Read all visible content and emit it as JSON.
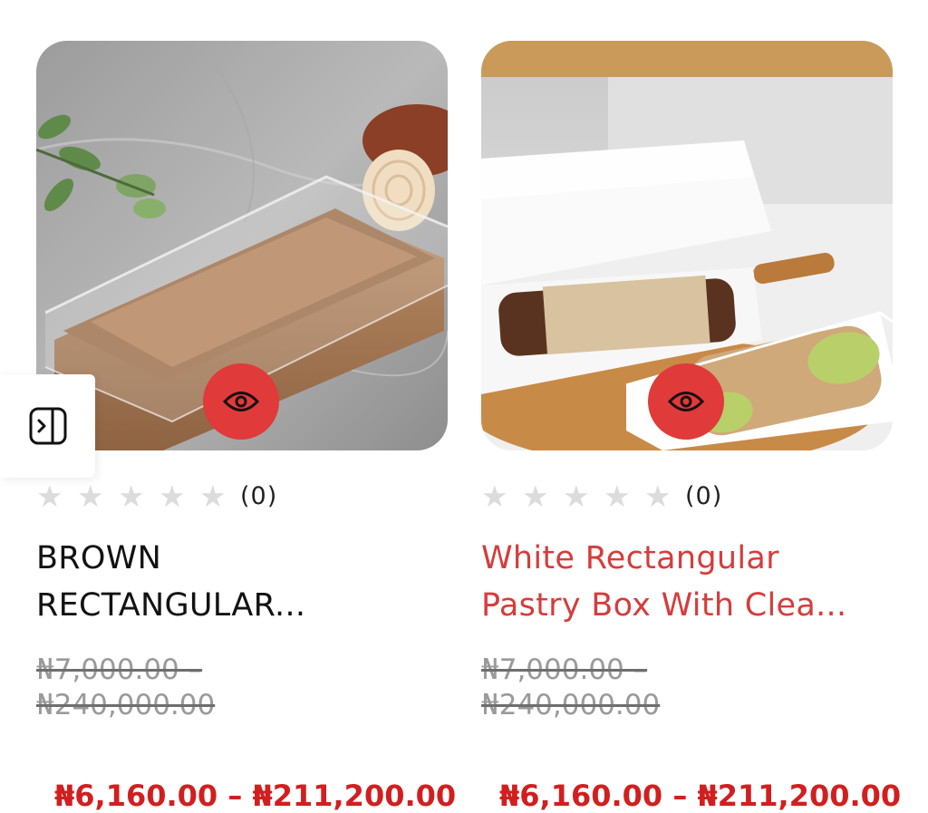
{
  "products": [
    {
      "title_lines": [
        "BROWN",
        "RECTANGULAR..."
      ],
      "rating_count": "(0)",
      "stars": 0,
      "old_price_lines": [
        "₦7,000.00 –",
        "₦240,000.00"
      ],
      "new_price": "₦6,160.00 – ₦211,200.00"
    },
    {
      "title_lines": [
        "White Rectangular",
        "Pastry Box With Clea..."
      ],
      "rating_count": "(0)",
      "stars": 0,
      "old_price_lines": [
        "₦7,000.00 –",
        "₦240,000.00"
      ],
      "new_price": "₦6,160.00 – ₦211,200.00"
    }
  ],
  "icons": {
    "quick_view": "eye-icon",
    "sidebar_toggle": "sidebar-expand-icon",
    "rating": "star-icon"
  },
  "colors": {
    "accent_red": "#e03a3a",
    "price_red": "#d11f1f",
    "title_red": "#d63c3c",
    "star_empty": "#dcdcdc",
    "strike_grey": "#9a9a9a"
  }
}
